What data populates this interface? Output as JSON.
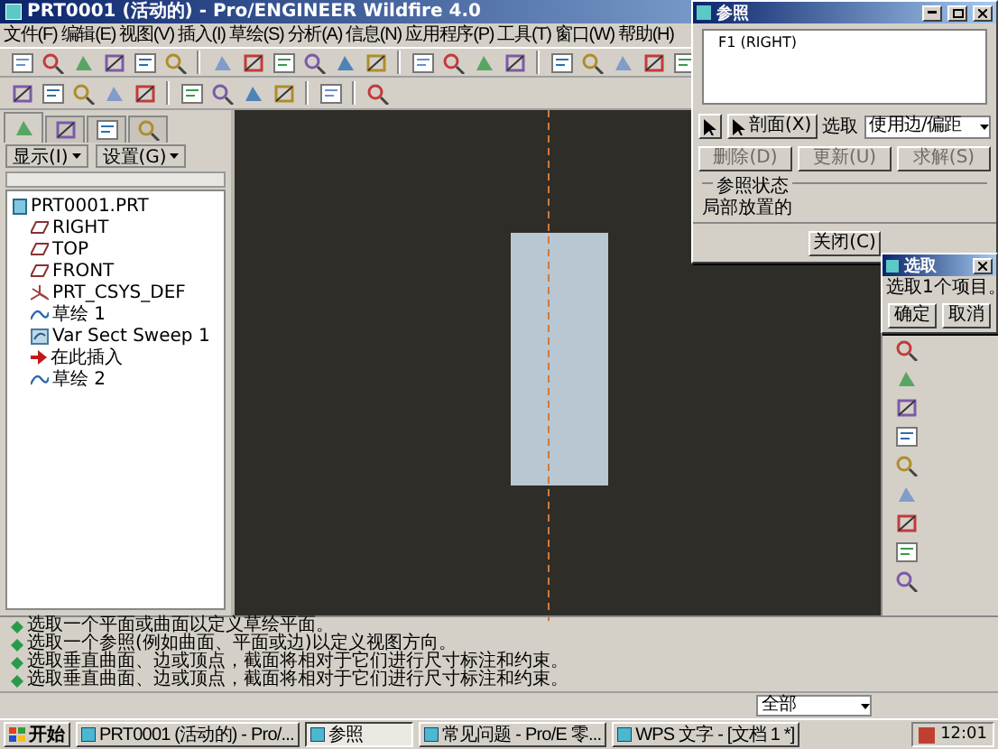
{
  "window": {
    "title": "PRT0001 (活动的) - Pro/ENGINEER Wildfire 4.0"
  },
  "menu": [
    "文件(F)",
    "编辑(E)",
    "视图(V)",
    "插入(I)",
    "草绘(S)",
    "分析(A)",
    "信息(N)",
    "应用程序(P)",
    "工具(T)",
    "窗口(W)",
    "帮助(H)"
  ],
  "model_tree": {
    "tabs": [
      {
        "selected": true
      },
      {
        "selected": false
      },
      {
        "selected": false
      },
      {
        "selected": false
      }
    ],
    "buttons": [
      "显示(I)",
      "设置(G)"
    ],
    "root": {
      "label": "PRT0001.PRT",
      "children": [
        {
          "label": "RIGHT",
          "kind": "plane"
        },
        {
          "label": "TOP",
          "kind": "plane"
        },
        {
          "label": "FRONT",
          "kind": "plane"
        },
        {
          "label": "PRT_CSYS_DEF",
          "kind": "csys"
        },
        {
          "label": "草绘 1",
          "kind": "sketch"
        },
        {
          "label": "Var Sect Sweep 1",
          "kind": "sweep"
        },
        {
          "label": "在此插入",
          "kind": "insert"
        },
        {
          "label": "草绘 2",
          "kind": "sketch"
        }
      ]
    }
  },
  "references_dialog": {
    "title": "参照",
    "references": [
      "F1 (RIGHT)"
    ],
    "section_button": "剖面(X)",
    "pick_label": "选取",
    "pick_value": "使用边/偏距",
    "actions": [
      {
        "label": "删除(D)",
        "disabled": true
      },
      {
        "label": "更新(U)",
        "disabled": true
      },
      {
        "label": "求解(S)",
        "disabled": true
      }
    ],
    "status_label": "参照状态",
    "status": "局部放置的",
    "close": "关闭(C)"
  },
  "select_dialog": {
    "title": "选取",
    "message": "选取1个项目。",
    "buttons": [
      "确定",
      "取消"
    ]
  },
  "messages": [
    "选取一个平面或曲面以定义草绘平面。",
    "选取一个参照(例如曲面、平面或边)以定义视图方向。",
    "选取垂直曲面、边或顶点，截面将相对于它们进行尺寸标注和约束。",
    "选取垂直曲面、边或顶点，截面将相对于它们进行尺寸标注和约束。"
  ],
  "filter": "全部",
  "taskbar": {
    "start": "开始",
    "items": [
      {
        "label": "PRT0001 (活动的) - Pro/...",
        "selected": false
      },
      {
        "label": "参照",
        "selected": true
      },
      {
        "label": "常见问题 - Pro/E 零...",
        "selected": false
      },
      {
        "label": "WPS 文字 - [文档 1 *]",
        "selected": false
      }
    ],
    "clock": "12:01"
  }
}
